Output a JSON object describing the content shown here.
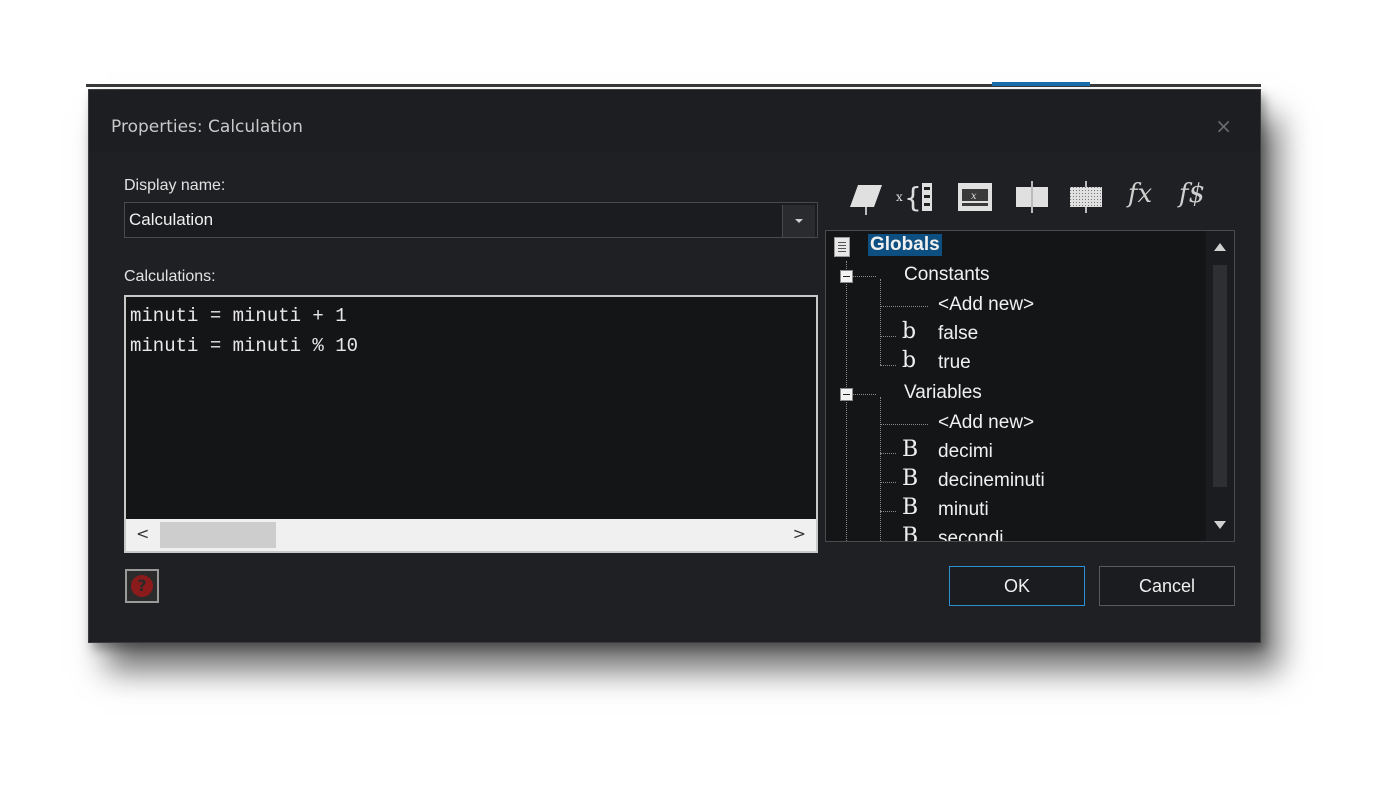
{
  "dialog": {
    "title": "Properties: Calculation",
    "close_glyph": "×"
  },
  "form": {
    "display_name_label": "Display name:",
    "display_name_value": "Calculation",
    "calculations_label": "Calculations:"
  },
  "editor": {
    "lines": [
      "minuti = minuti + 1",
      "minuti = minuti % 10"
    ],
    "scroll_left": "<",
    "scroll_right": ">"
  },
  "toolbar": {
    "icons": [
      "parallelogram-icon",
      "brace-variable-icon",
      "expression-box-icon",
      "block-icon",
      "hatched-block-icon",
      "function-icon",
      "string-function-icon"
    ],
    "fx_label": "fx",
    "fs_label": "f$"
  },
  "tree": {
    "root": "Globals",
    "constants": {
      "label": "Constants",
      "items": [
        "<Add new>",
        "false",
        "true"
      ]
    },
    "variables": {
      "label": "Variables",
      "items": [
        "<Add new>",
        "decimi",
        "decineminuti",
        "minuti",
        "secondi"
      ]
    },
    "bool_glyph": "b",
    "byte_glyph": "B"
  },
  "buttons": {
    "help": "?",
    "ok": "OK",
    "cancel": "Cancel"
  },
  "colors": {
    "background": "#1f2023",
    "selection": "#0d4f80",
    "primary_border": "#2e8fd6",
    "help_red": "#8b1a1a"
  }
}
